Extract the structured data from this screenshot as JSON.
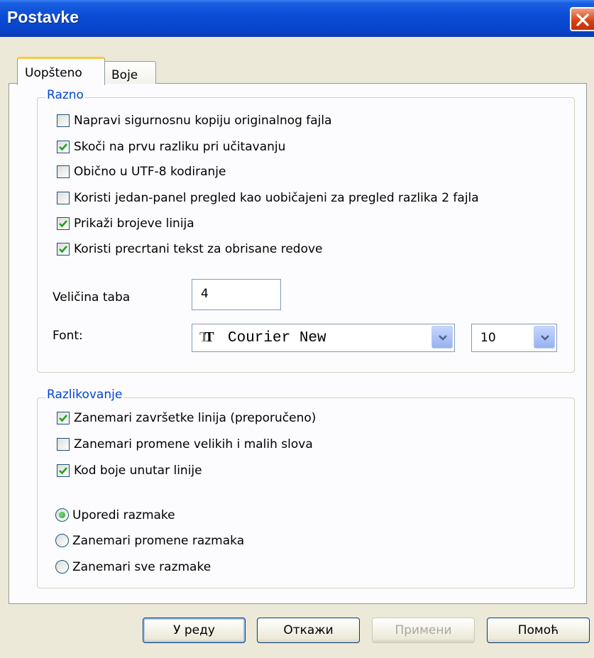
{
  "window": {
    "title": "Postavke"
  },
  "tabs": [
    {
      "label": "Uopšteno",
      "active": true
    },
    {
      "label": "Boje",
      "active": false
    }
  ],
  "razno": {
    "legend": "Razno",
    "checkboxes": [
      {
        "label": "Napravi sigurnosnu kopiju originalnog fajla",
        "checked": false
      },
      {
        "label": "Skoči na prvu razliku pri učitavanju",
        "checked": true
      },
      {
        "label": "Obično u UTF-8 kodiranje",
        "checked": false
      },
      {
        "label": "Koristi jedan-panel pregled kao uobičajeni za pregled razlika 2 fajla",
        "checked": false
      },
      {
        "label": "Prikaži brojeve linija",
        "checked": true
      },
      {
        "label": "Koristi precrtani tekst za obrisane redove",
        "checked": true
      }
    ],
    "tab_size_label": "Veličina taba",
    "tab_size_value": "4",
    "font_label": "Font:",
    "font_name": "Courier New",
    "font_icon": "truetype-font-icon",
    "font_size": "10"
  },
  "razlikovanje": {
    "legend": "Razlikovanje",
    "checkboxes": [
      {
        "label": "Zanemari završetke linija (preporučeno)",
        "checked": true
      },
      {
        "label": "Zanemari promene velikih i malih slova",
        "checked": false
      },
      {
        "label": "Kod boje unutar linije",
        "checked": true
      }
    ],
    "radios": [
      {
        "label": "Uporedi razmake",
        "selected": true
      },
      {
        "label": "Zanemari promene razmaka",
        "selected": false
      },
      {
        "label": "Zanemari sve razmake",
        "selected": false
      }
    ]
  },
  "buttons": {
    "ok": "У реду",
    "cancel": "Откажи",
    "apply": "Примени",
    "help": "Помоћ"
  },
  "colors": {
    "titlebar": "#0a4bd6",
    "accent_legend": "#0046d5",
    "check_mark": "#21a121"
  }
}
